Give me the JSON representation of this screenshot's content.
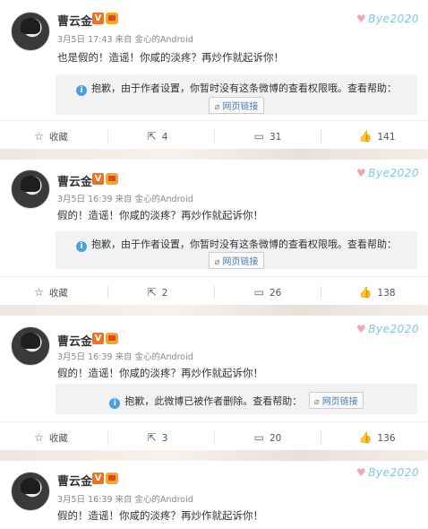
{
  "posts": [
    {
      "name": "曹云金",
      "v_badge": "V",
      "meta": "3月5日 17:43 来自 金心的Android",
      "text": "也是假的！造谣！你咸的淡疼？再炒作就起诉你！",
      "notice": "抱歉，由于作者设置，你暂时没有这条微博的查看权限哦。查看帮助：",
      "link_label": "网页链接",
      "favorite_label": "收藏",
      "repost_count": "4",
      "comment_count": "31",
      "like_count": "141"
    },
    {
      "name": "曹云金",
      "v_badge": "V",
      "meta": "3月5日 16:39 来自 金心的Android",
      "text": "假的！造谣！你咸的淡疼？再炒作就起诉你！",
      "notice": "抱歉，由于作者设置，你暂时没有这条微博的查看权限哦。查看帮助：",
      "link_label": "网页链接",
      "favorite_label": "收藏",
      "repost_count": "2",
      "comment_count": "26",
      "like_count": "138"
    },
    {
      "name": "曹云金",
      "v_badge": "V",
      "meta": "3月5日 16:39 来自 金心的Android",
      "text": "假的！造谣！你咸的淡疼？再炒作就起诉你！",
      "notice": "抱歉，此微博已被作者删除。查看帮助：",
      "link_label": "网页链接",
      "favorite_label": "收藏",
      "repost_count": "3",
      "comment_count": "20",
      "like_count": "136"
    },
    {
      "name": "曹云金",
      "v_badge": "V",
      "meta": "3月5日 16:39 来自 金心的Android",
      "text": "假的！造谣！你咸的淡疼？再炒作就起诉你！"
    }
  ],
  "watermark": "Bye2020",
  "icons": {
    "favorite": "star-outline-icon",
    "repost": "share-arrow-icon",
    "comment": "comment-bubble-icon",
    "like": "thumbs-up-icon",
    "info": "info-circle-icon",
    "link": "paperclip-link-icon"
  },
  "colors": {
    "name_text": "#333333",
    "v_badge": "#f36f21",
    "info_blue": "#4a9fe0",
    "link_blue": "#4a7bb5",
    "notice_bg": "#f2f2f5",
    "watermark": "#7ec8ea"
  }
}
